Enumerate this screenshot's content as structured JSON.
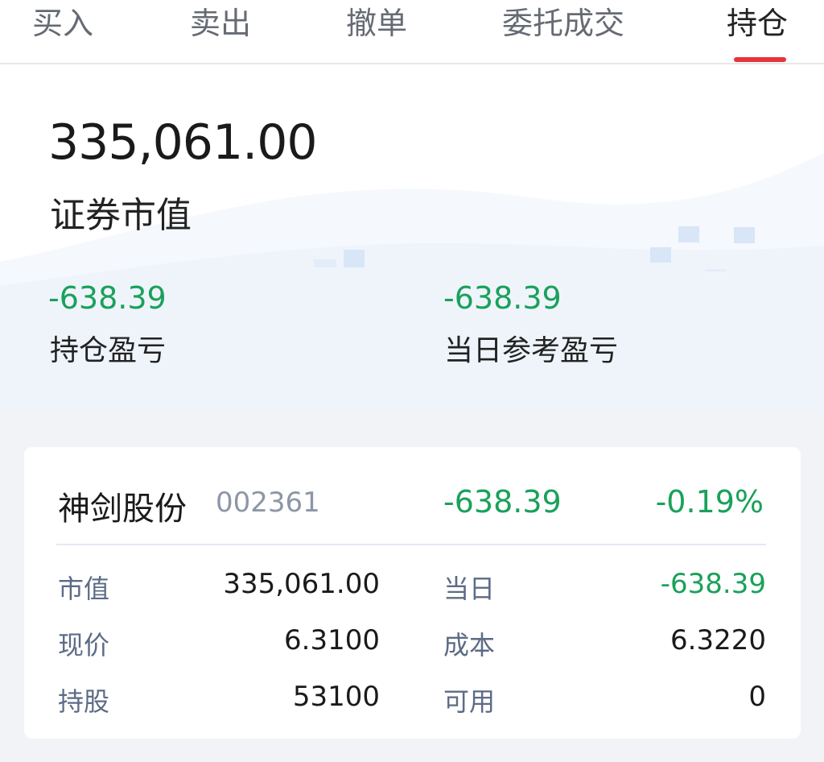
{
  "tabs": [
    {
      "label": "买入",
      "active": false
    },
    {
      "label": "卖出",
      "active": false
    },
    {
      "label": "撤单",
      "active": false
    },
    {
      "label": "委托成交",
      "active": false
    },
    {
      "label": "持仓",
      "active": true
    }
  ],
  "summary": {
    "market_value": "335,061.00",
    "market_value_label": "证券市值",
    "position_pnl": "-638.39",
    "position_pnl_label": "持仓盈亏",
    "daily_pnl": "-638.39",
    "daily_pnl_label": "当日参考盈亏"
  },
  "holding": {
    "name": "神剑股份",
    "code": "002361",
    "pnl": "-638.39",
    "pnl_pct": "-0.19%",
    "rows": [
      {
        "left_label": "市值",
        "left_value": "335,061.00",
        "right_label": "当日",
        "right_value": "-638.39"
      },
      {
        "left_label": "现价",
        "left_value": "6.3100",
        "right_label": "成本",
        "right_value": "6.3220"
      },
      {
        "left_label": "持股",
        "left_value": "53100",
        "right_label": "可用",
        "right_value": "0"
      }
    ]
  },
  "colors": {
    "loss_green": "#1aa15a",
    "tab_indicator": "#e8333a",
    "label_blue_gray": "#5c6b86"
  }
}
